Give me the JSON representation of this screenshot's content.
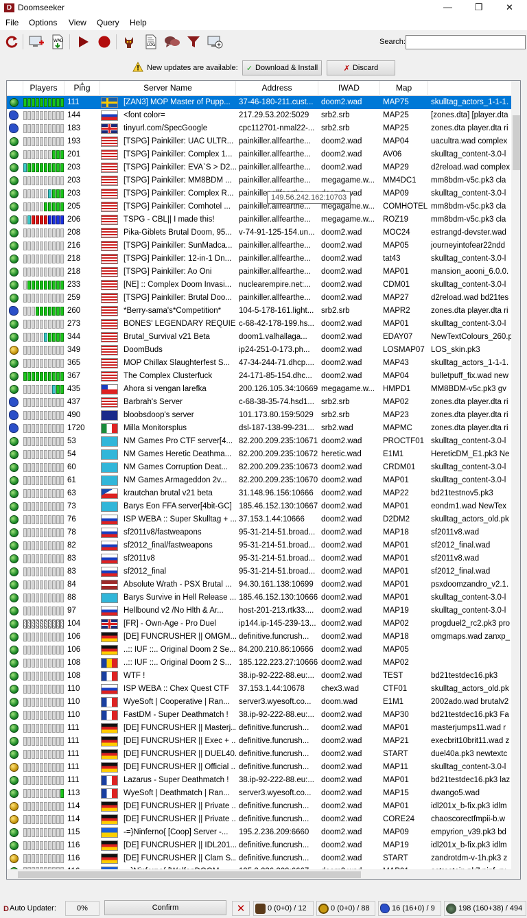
{
  "window": {
    "title": "Doomseeker",
    "app_icon": "D"
  },
  "menu": [
    "File",
    "Options",
    "View",
    "Query",
    "Help"
  ],
  "toolbar": {
    "icons": [
      "refresh-icon",
      "create-game-icon",
      "wad-download-icon",
      "play-icon",
      "record-icon",
      "demo-icon",
      "log-icon",
      "chat-icon",
      "filter-icon",
      "add-server-icon"
    ],
    "search_label": "Search:",
    "search_value": ""
  },
  "updates": {
    "message": "New updates are available:",
    "download_label": "Download & Install",
    "discard_label": "Discard"
  },
  "table": {
    "columns": [
      "Players",
      "Ping",
      "Server Name",
      "Address",
      "IWAD",
      "Map"
    ],
    "tooltip": "149.56.242.162:10703",
    "rows": [
      {
        "icon": "globe",
        "bar": "gggggggggg",
        "ping": "111",
        "flag": "se",
        "name": "[ZAN3] MOP Master of Pupp...",
        "address": "37-46-180-211.cust...",
        "iwad": "doom2.wad",
        "map": "MAP75",
        "wads": "skulltag_actors_1-1-1.",
        "sel": true
      },
      {
        "icon": "sonic",
        "bar": "eeeeeeeeee",
        "ping": "144",
        "flag": "ru",
        "name": "<font color=",
        "address": "217.29.53.202:5029",
        "iwad": "srb2.srb",
        "map": "MAP25",
        "wads": "[zones.dta] [player.dta"
      },
      {
        "icon": "sonic",
        "bar": "eeeeeeeeee",
        "ping": "183",
        "flag": "gb",
        "name": "tinyurl.com/SpecGoogle",
        "address": "cpc112701-nmal22-...",
        "iwad": "srb2.srb",
        "map": "MAP25",
        "wads": "zones.dta player.dta ri"
      },
      {
        "icon": "globe",
        "bar": "eeeeeeeeee",
        "ping": "193",
        "flag": "us",
        "name": "[TSPG] Painkiller: UAC ULTR...",
        "address": "painkiller.allfearthe...",
        "iwad": "doom2.wad",
        "map": "MAP04",
        "wads": "uacultra.wad complex"
      },
      {
        "icon": "globe",
        "bar": "eeeeeeeggg",
        "ping": "201",
        "flag": "us",
        "name": "[TSPG] Painkiller: Complex 1...",
        "address": "painkiller.allfearthe...",
        "iwad": "doom2.wad",
        "map": "AV06",
        "wads": "skulltag_content-3.0-l"
      },
      {
        "icon": "globe",
        "bar": "tggggggggg",
        "ping": "203",
        "flag": "us",
        "name": "[TSPG] Painkiller: EVA`S > D2...",
        "address": "painkiller.allfearthe...",
        "iwad": "doom2.wad",
        "map": "MAP29",
        "wads": "d2reload.wad complex"
      },
      {
        "icon": "globe",
        "bar": "eeeeeeeeee",
        "ping": "203",
        "flag": "us",
        "name": "[TSPG] Painkiller: MM8BDM ...",
        "address": "painkiller.allfearthe...",
        "iwad": "megagame.w...",
        "map": "MM4DC1",
        "wads": "mm8bdm-v5c.pk3 cla"
      },
      {
        "icon": "globe",
        "bar": "eeeeeetggg",
        "ping": "203",
        "flag": "us",
        "name": "[TSPG] Painkiller: Complex R...",
        "address": "painkiller.allfearthe...",
        "iwad": "doom2.wad",
        "map": "MAP09",
        "wads": "skulltag_content-3.0-l"
      },
      {
        "icon": "globe",
        "bar": "eeeeeggggg",
        "ping": "205",
        "flag": "us",
        "name": "[TSPG] Painkiller: Comhotel ...",
        "address": "painkiller.allfearthe...",
        "iwad": "megagame.w...",
        "map": "COMHOTEL",
        "wads": "mm8bdm-v5c.pk3 cla"
      },
      {
        "icon": "globe",
        "bar": "etrrrrbbbb",
        "ping": "206",
        "flag": "us",
        "name": "TSPG - CBL|| I made this!",
        "address": "painkiller.allfearthe...",
        "iwad": "megagame.w...",
        "map": "ROZ19",
        "wads": "mm8bdm-v5c.pk3 cla"
      },
      {
        "icon": "globe",
        "bar": "eeeeeeeeee",
        "ping": "208",
        "flag": "us",
        "name": "Pika-Giblets Brutal Doom, 95...",
        "address": "v-74-91-125-154.un...",
        "iwad": "doom2.wad",
        "map": "MOC24",
        "wads": "estrangd-devster.wad"
      },
      {
        "icon": "globe",
        "bar": "eeeeeeeeee",
        "ping": "216",
        "flag": "us",
        "name": "[TSPG] Painkiller: SunMadca...",
        "address": "painkiller.allfearthe...",
        "iwad": "doom2.wad",
        "map": "MAP05",
        "wads": "journeyintofear22ndd"
      },
      {
        "icon": "globe",
        "bar": "eeeeeeeeee",
        "ping": "218",
        "flag": "us",
        "name": "[TSPG] Painkiller: 12-in-1 Dn...",
        "address": "painkiller.allfearthe...",
        "iwad": "doom2.wad",
        "map": "tat43",
        "wads": "skulltag_content-3.0-l"
      },
      {
        "icon": "globe",
        "bar": "eeeeeeeeee",
        "ping": "218",
        "flag": "us",
        "name": "[TSPG] Painkiller: Ao Oni",
        "address": "painkiller.allfearthe...",
        "iwad": "doom2.wad",
        "map": "MAP01",
        "wads": "mansion_aooni_6.0.0."
      },
      {
        "icon": "globe",
        "bar": "eggggggggg",
        "ping": "233",
        "flag": "us",
        "name": "[NE] :: Complex Doom Invasi...",
        "address": "nuclearempire.net:...",
        "iwad": "doom2.wad",
        "map": "CDM01",
        "wads": "skulltag_content-3.0-l"
      },
      {
        "icon": "globe",
        "bar": "eeeeeeeeee",
        "ping": "259",
        "flag": "us",
        "name": "[TSPG] Painkiller: Brutal Doo...",
        "address": "painkiller.allfearthe...",
        "iwad": "doom2.wad",
        "map": "MAP27",
        "wads": "d2reload.wad bd21tes"
      },
      {
        "icon": "sonic",
        "bar": "eeeggggggg",
        "ping": "260",
        "flag": "us",
        "name": "*Berry-sama's*Competition*",
        "address": "104-5-178-161.light...",
        "iwad": "srb2.srb",
        "map": "MAPR2",
        "wads": "zones.dta player.dta ri"
      },
      {
        "icon": "globe",
        "bar": "eeeeeeeeee",
        "ping": "273",
        "flag": "us",
        "name": "BONES' LEGENDARY REQUIEM",
        "address": "c-68-42-178-199.hs...",
        "iwad": "doom2.wad",
        "map": "MAP01",
        "wads": "skulltag_content-3.0-l"
      },
      {
        "icon": "globe",
        "bar": "eeeeetgggg",
        "ping": "344",
        "flag": "us",
        "name": "Brutal_Survival v21 Beta",
        "address": "doom1.valhallaga...",
        "iwad": "doom2.wad",
        "map": "EDAY07",
        "wads": "NewTextColours_260.p"
      },
      {
        "icon": "lock",
        "bar": "eeeeeeeeee",
        "ping": "349",
        "flag": "us",
        "name": "DoomBuds",
        "address": "ip24-251-0-173.ph...",
        "iwad": "doom2.wad",
        "map": "LOSMAP07",
        "wads": "LOS_skin.pk3"
      },
      {
        "icon": "globe",
        "bar": "eeeeeeeeee",
        "ping": "365",
        "flag": "us",
        "name": "MOP Chillax Slaughterfest S...",
        "address": "47-34-244-71.dhcp....",
        "iwad": "doom2.wad",
        "map": "MAP43",
        "wads": "skulltag_actors_1-1-1."
      },
      {
        "icon": "globe",
        "bar": "gggggggggg",
        "ping": "367",
        "flag": "us",
        "name": "The Complex Clusterfuck",
        "address": "24-171-85-154.dhc...",
        "iwad": "doom2.wad",
        "map": "MAP04",
        "wads": "bulletpuff_fix.wad new"
      },
      {
        "icon": "globe",
        "bar": "eeeeeeetgg",
        "ping": "435",
        "flag": "cl",
        "name": "Ahora si vengan larefka",
        "address": "200.126.105.34:10669",
        "iwad": "megagame.w...",
        "map": "HMPD1",
        "wads": "MM8BDM-v5c.pk3 gv"
      },
      {
        "icon": "sonic",
        "bar": "eeeeeeeeee",
        "ping": "437",
        "flag": "us",
        "name": "Barbrah's Server",
        "address": "c-68-38-35-74.hsd1...",
        "iwad": "srb2.srb",
        "map": "MAP02",
        "wads": "zones.dta player.dta ri"
      },
      {
        "icon": "sonic",
        "bar": "eeeeeeeeee",
        "ping": "490",
        "flag": "au",
        "name": "bloobsdoop's server",
        "address": "101.173.80.159:5029",
        "iwad": "srb2.srb",
        "map": "MAP23",
        "wads": "zones.dta player.dta ri"
      },
      {
        "icon": "sonic",
        "bar": "eeeeeeeeee",
        "ping": "1720",
        "flag": "mx",
        "name": "Milla Monitorsplus",
        "address": "dsl-187-138-99-231...",
        "iwad": "srb2.wad",
        "map": "MAPMC",
        "wads": "zones.dta player.dta ri"
      },
      {
        "icon": "globe",
        "bar": "eeeeeeeeee",
        "ping": "53",
        "flag": "kz",
        "name": "NM Games Pro CTF server[4...",
        "address": "82.200.209.235:10671",
        "iwad": "doom2.wad",
        "map": "PROCTF01",
        "wads": "skulltag_content-3.0-l"
      },
      {
        "icon": "globe",
        "bar": "eeeeeeeeee",
        "ping": "54",
        "flag": "kz",
        "name": "NM Games Heretic Deathma...",
        "address": "82.200.209.235:10672",
        "iwad": "heretic.wad",
        "map": "E1M1",
        "wads": "HereticDM_E1.pk3 Ne"
      },
      {
        "icon": "globe",
        "bar": "eeeeeeeeee",
        "ping": "60",
        "flag": "kz",
        "name": "NM Games Corruption Deat...",
        "address": "82.200.209.235:10673",
        "iwad": "doom2.wad",
        "map": "CRDM01",
        "wads": "skulltag_content-3.0-l"
      },
      {
        "icon": "globe",
        "bar": "eeeeeeeeee",
        "ping": "61",
        "flag": "kz",
        "name": "NM Games Armageddon 2v...",
        "address": "82.200.209.235:10670",
        "iwad": "doom2.wad",
        "map": "MAP01",
        "wads": "skulltag_content-3.0-l"
      },
      {
        "icon": "globe",
        "bar": "eeeeeeeeee",
        "ping": "63",
        "flag": "cz",
        "name": "krautchan brutal v21 beta",
        "address": "31.148.96.156:10666",
        "iwad": "doom2.wad",
        "map": "MAP22",
        "wads": "bd21testnov5.pk3"
      },
      {
        "icon": "globe",
        "bar": "eeeeeeeeee",
        "ping": "73",
        "flag": "kz",
        "name": "Barys Eon FFA server[4bit-GC]",
        "address": "185.46.152.130:10667",
        "iwad": "doom2.wad",
        "map": "MAP01",
        "wads": "eondm1.wad NewTex"
      },
      {
        "icon": "globe",
        "bar": "eeeeeeeeee",
        "ping": "76",
        "flag": "ru",
        "name": "ISP WEBA :: Super Skulltag + ...",
        "address": "37.153.1.44:10666",
        "iwad": "doom2.wad",
        "map": "D2DM2",
        "wads": "skulltag_actors_old.pk"
      },
      {
        "icon": "globe",
        "bar": "eeeeeeeeee",
        "ping": "78",
        "flag": "ru",
        "name": "sf2011v8/fastweapons",
        "address": "95-31-214-51.broad...",
        "iwad": "doom2.wad",
        "map": "MAP18",
        "wads": "sf2011v8.wad"
      },
      {
        "icon": "globe",
        "bar": "eeeeeeeeee",
        "ping": "82",
        "flag": "ru",
        "name": "sf2012_final/fastweapons",
        "address": "95-31-214-51.broad...",
        "iwad": "doom2.wad",
        "map": "MAP01",
        "wads": "sf2012_final.wad"
      },
      {
        "icon": "globe",
        "bar": "eeeeeeeeee",
        "ping": "83",
        "flag": "ru",
        "name": "sf2011v8",
        "address": "95-31-214-51.broad...",
        "iwad": "doom2.wad",
        "map": "MAP01",
        "wads": "sf2011v8.wad"
      },
      {
        "icon": "globe",
        "bar": "eeeeeeeeee",
        "ping": "83",
        "flag": "ru",
        "name": "sf2012_final",
        "address": "95-31-214-51.broad...",
        "iwad": "doom2.wad",
        "map": "MAP01",
        "wads": "sf2012_final.wad"
      },
      {
        "icon": "globe",
        "bar": "eeeeeeeeee",
        "ping": "84",
        "flag": "lv",
        "name": "Absolute Wrath - PSX Brutal ...",
        "address": "94.30.161.138:10699",
        "iwad": "doom2.wad",
        "map": "MAP01",
        "wads": "psxdoomzandro_v2.1."
      },
      {
        "icon": "globe",
        "bar": "eeeeeeeeee",
        "ping": "88",
        "flag": "kz",
        "name": "Barys Survive in Hell Release ...",
        "address": "185.46.152.130:10666",
        "iwad": "doom2.wad",
        "map": "MAP01",
        "wads": "skulltag_content-3.0-l"
      },
      {
        "icon": "globe",
        "bar": "eeeeeeeeee",
        "ping": "97",
        "flag": "ru",
        "name": "Hellbound v2 /No Hlth & Ar...",
        "address": "host-201-213.rtk33....",
        "iwad": "doom2.wad",
        "map": "MAP19",
        "wads": "skulltag_content-3.0-l"
      },
      {
        "icon": "globe",
        "bar": "ssssssssss",
        "ping": "104",
        "flag": "gb",
        "name": "[FR] - Own-Age - Pro Duel",
        "address": "ip144.ip-145-239-13...",
        "iwad": "doom2.wad",
        "map": "MAP02",
        "wads": "progduel2_rc2.pk3 pro"
      },
      {
        "icon": "globe",
        "bar": "eeeeeeeeee",
        "ping": "106",
        "flag": "de",
        "name": "[DE] FUNCRUSHER || OMGM...",
        "address": "definitive.funcrush...",
        "iwad": "doom2.wad",
        "map": "MAP18",
        "wads": "omgmaps.wad zanxp_"
      },
      {
        "icon": "globe",
        "bar": "eeeeeeeeee",
        "ping": "106",
        "flag": "de",
        "name": "..:: IUF ::.. Original Doom 2 Se...",
        "address": "84.200.210.86:10666",
        "iwad": "doom2.wad",
        "map": "MAP05",
        "wads": ""
      },
      {
        "icon": "globe",
        "bar": "eeeeeeeeee",
        "ping": "108",
        "flag": "ro",
        "name": "..:: IUF ::.. Original Doom 2 S...",
        "address": "185.122.223.27:10666",
        "iwad": "doom2.wad",
        "map": "MAP02",
        "wads": ""
      },
      {
        "icon": "globe",
        "bar": "eeeeeeeeee",
        "ping": "108",
        "flag": "fr",
        "name": "WTF !",
        "address": "38.ip-92-222-88.eu:...",
        "iwad": "doom2.wad",
        "map": "TEST",
        "wads": "bd21testdec16.pk3"
      },
      {
        "icon": "globe",
        "bar": "eeeeeeeeee",
        "ping": "110",
        "flag": "ru",
        "name": "ISP WEBA :: Chex Quest CTF",
        "address": "37.153.1.44:10678",
        "iwad": "chex3.wad",
        "map": "CTF01",
        "wads": "skulltag_actors_old.pk"
      },
      {
        "icon": "globe",
        "bar": "eeeeeeeeee",
        "ping": "110",
        "flag": "fr",
        "name": "WyeSoft | Cooperative | Ran...",
        "address": "server3.wyesoft.co...",
        "iwad": "doom.wad",
        "map": "E1M1",
        "wads": "2002ado.wad brutalv2"
      },
      {
        "icon": "globe",
        "bar": "eeeeeeeeee",
        "ping": "110",
        "flag": "fr",
        "name": "FastDM - Super Deathmatch !",
        "address": "38.ip-92-222-88.eu:...",
        "iwad": "doom2.wad",
        "map": "MAP30",
        "wads": "bd21testdec16.pk3 Fa"
      },
      {
        "icon": "globe",
        "bar": "eeeeeeeeee",
        "ping": "111",
        "flag": "de",
        "name": "[DE] FUNCRUSHER || Masterj...",
        "address": "definitive.funcrush...",
        "iwad": "doom2.wad",
        "map": "MAP01",
        "wads": "masterjumps11.wad r"
      },
      {
        "icon": "globe",
        "bar": "eeeeeeeeee",
        "ping": "111",
        "flag": "de",
        "name": "[DE] FUNCRUSHER || Exec + ...",
        "address": "definitive.funcrush...",
        "iwad": "doom2.wad",
        "map": "MAP21",
        "wads": "execbrit10brit11.wad z"
      },
      {
        "icon": "globe",
        "bar": "eeeeeeeeee",
        "ping": "111",
        "flag": "de",
        "name": "[DE] FUNCRUSHER || DUEL40...",
        "address": "definitive.funcrush...",
        "iwad": "doom2.wad",
        "map": "START",
        "wads": "duel40a.pk3 newtextc"
      },
      {
        "icon": "lock",
        "bar": "eeeeeeeeee",
        "ping": "111",
        "flag": "de",
        "name": "[DE] FUNCRUSHER || Official ...",
        "address": "definitive.funcrush...",
        "iwad": "doom2.wad",
        "map": "MAP11",
        "wads": "skulltag_content-3.0-l"
      },
      {
        "icon": "globe",
        "bar": "eeeeeeeeee",
        "ping": "111",
        "flag": "fr",
        "name": "Lazarus - Super Deathmatch !",
        "address": "38.ip-92-222-88.eu:...",
        "iwad": "doom2.wad",
        "map": "MAP01",
        "wads": "bd21testdec16.pk3 laz"
      },
      {
        "icon": "globe",
        "bar": "eeeeeeeeeg",
        "ping": "113",
        "flag": "fr",
        "name": "WyeSoft | Deathmatch | Ran...",
        "address": "server3.wyesoft.co...",
        "iwad": "doom2.wad",
        "map": "MAP15",
        "wads": "dwango5.wad"
      },
      {
        "icon": "lock",
        "bar": "eeeeeeeeee",
        "ping": "114",
        "flag": "de",
        "name": "[DE] FUNCRUSHER || Private ...",
        "address": "definitive.funcrush...",
        "iwad": "doom2.wad",
        "map": "MAP01",
        "wads": "idl201x_b-fix.pk3 idlm"
      },
      {
        "icon": "lock",
        "bar": "eeeeeeeeee",
        "ping": "114",
        "flag": "de",
        "name": "[DE] FUNCRUSHER || Private ...",
        "address": "definitive.funcrush...",
        "iwad": "doom2.wad",
        "map": "CORE24",
        "wads": "chaoscorectfmpii-b.w"
      },
      {
        "icon": "globe",
        "bar": "eeeeeeeeee",
        "ping": "115",
        "flag": "ua",
        "name": "-=}Ninferno{ [Coop] Server -...",
        "address": "195.2.236.209:6660",
        "iwad": "doom2.wad",
        "map": "MAP09",
        "wads": "empyrion_v39.pk3 bd"
      },
      {
        "icon": "globe",
        "bar": "eeeeeeeeee",
        "ping": "116",
        "flag": "de",
        "name": "[DE] FUNCRUSHER || IDL201...",
        "address": "definitive.funcrush...",
        "iwad": "doom2.wad",
        "map": "MAP19",
        "wads": "idl201x_b-fix.pk3 idlm"
      },
      {
        "icon": "lock",
        "bar": "eeeeeeeeee",
        "ping": "116",
        "flag": "de",
        "name": "[DE] FUNCRUSHER || Clam S...",
        "address": "definitive.funcrush...",
        "iwad": "doom2.wad",
        "map": "START",
        "wads": "zandrotdm-v-1h.pk3 z"
      },
      {
        "icon": "globe",
        "bar": "eeeeeeeeee",
        "ping": "116",
        "flag": "ua",
        "name": "-=}Ninferno{ [WolfenDOOM...",
        "address": "195.2.236.209:6667",
        "iwad": "doom2.wad",
        "map": "MAP01",
        "wads": "astrostein.pk7 ninf_ru"
      }
    ]
  },
  "status": {
    "auto_updater_label": "Auto Updater:",
    "progress": "0%",
    "confirm_label": "Confirm",
    "zandronum_count": "0 (0+0) / 12",
    "odamex_count": "0 (0+0) / 88",
    "srb2_count": "16 (16+0) / 9",
    "total_count": "198 (160+38) / 494"
  }
}
